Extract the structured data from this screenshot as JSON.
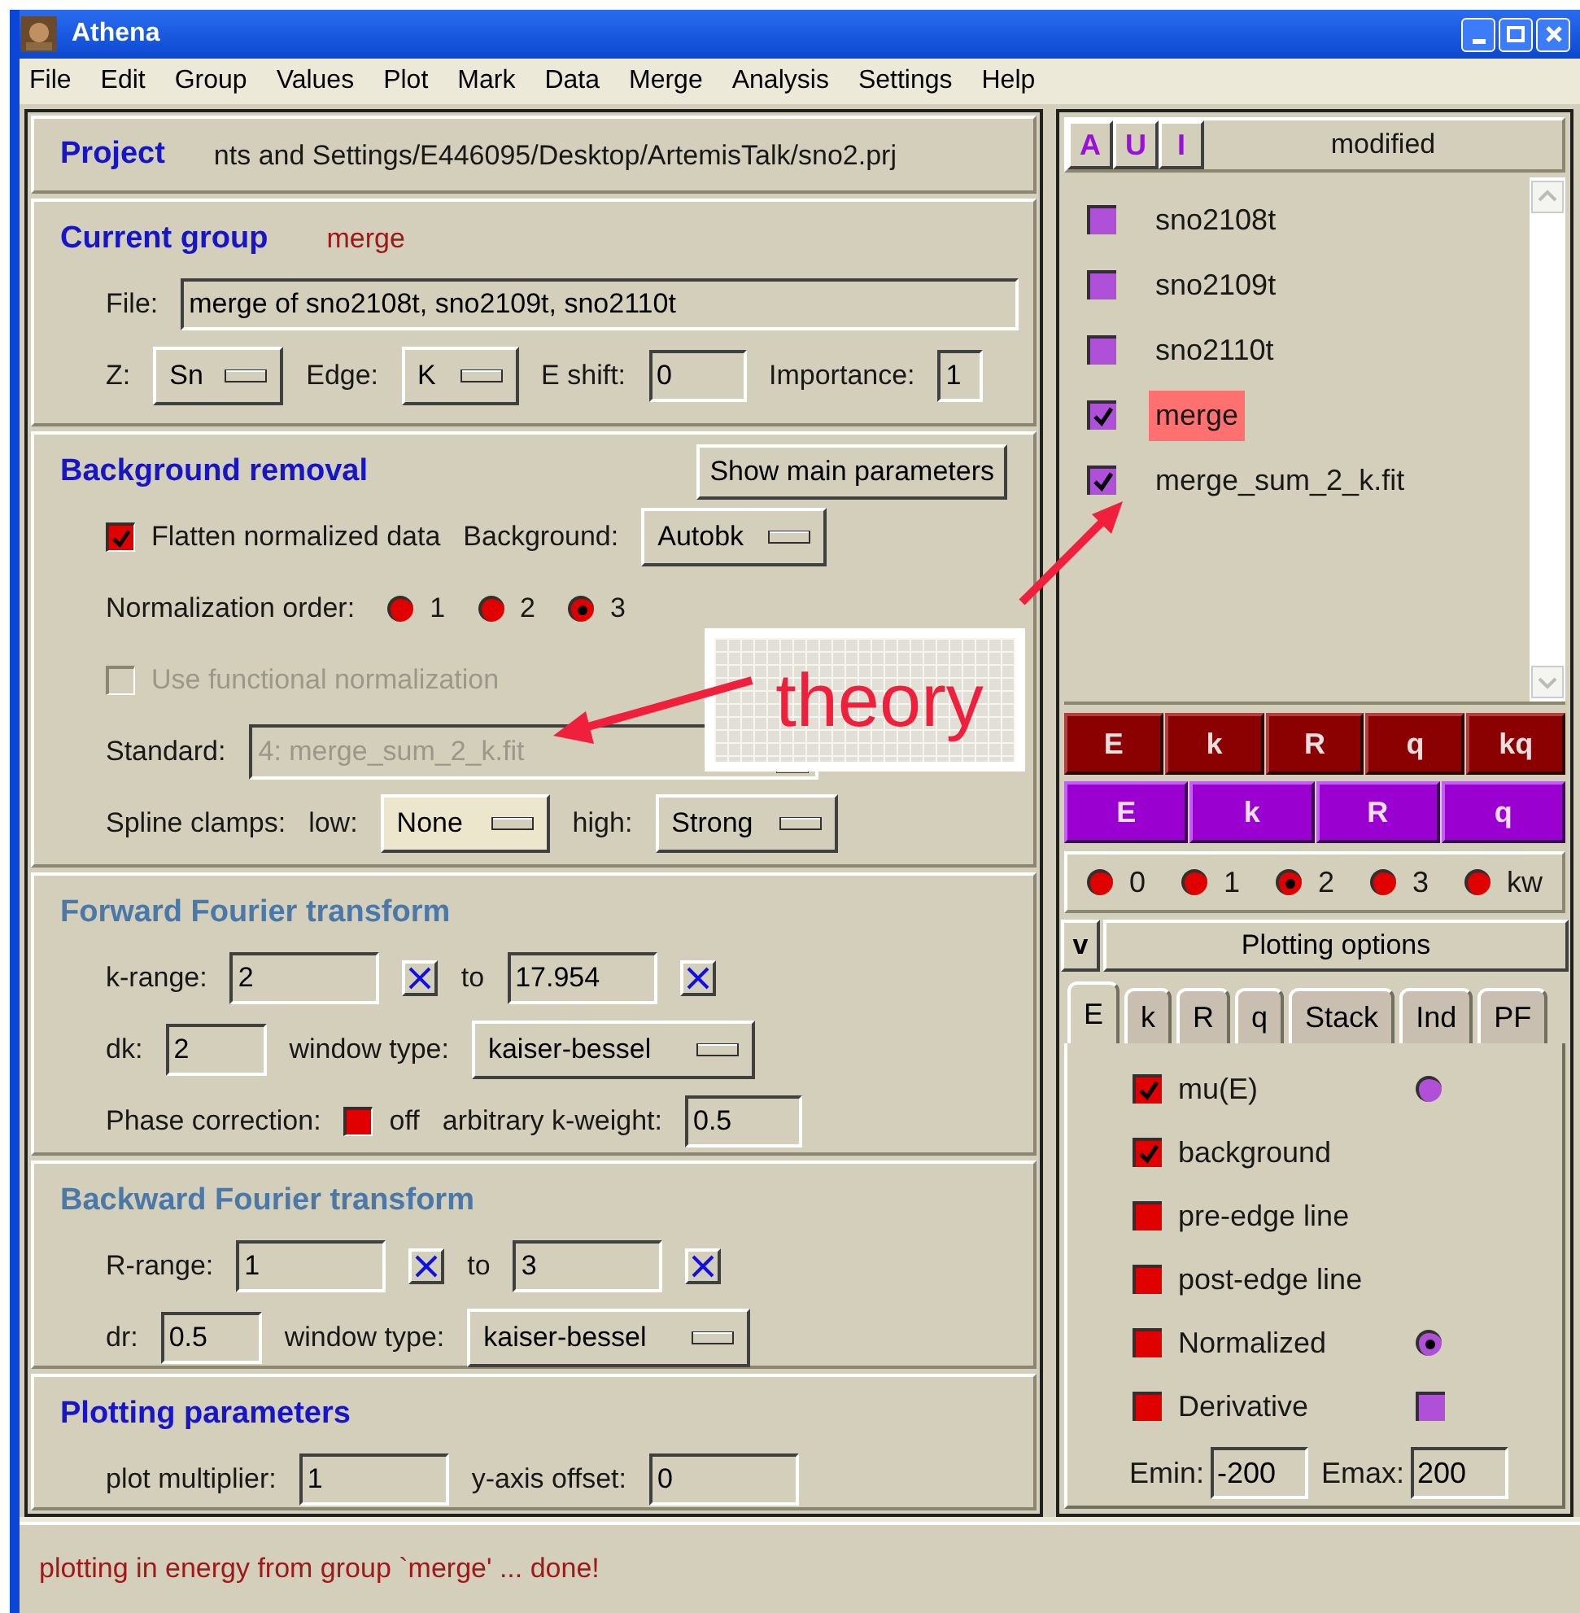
{
  "window": {
    "title": "Athena"
  },
  "menu": [
    {
      "label": "File"
    },
    {
      "label": "Edit"
    },
    {
      "label": "Group"
    },
    {
      "label": "Values"
    },
    {
      "label": "Plot"
    },
    {
      "label": "Mark"
    },
    {
      "label": "Data"
    },
    {
      "label": "Merge"
    },
    {
      "label": "Analysis"
    },
    {
      "label": "Settings"
    },
    {
      "label": "Help"
    }
  ],
  "sections": [
    {
      "dimmed": false,
      "header": [
        {
          "kind": "title",
          "text": "Project"
        },
        {
          "kind": "path",
          "text": "nts and Settings/E446095/Desktop/ArtemisTalk/sno2.prj"
        }
      ]
    },
    {
      "dimmed": false,
      "header": [
        {
          "kind": "title",
          "text": "Current group"
        },
        {
          "kind": "group-name",
          "text": "merge"
        }
      ],
      "rows": [
        {
          "controls": [
            {
              "kind": "label",
              "text": "File:"
            },
            {
              "kind": "field",
              "value": "merge of sno2108t, sno2109t, sno2110t"
            }
          ]
        },
        {
          "controls": [
            {
              "kind": "label",
              "text": "Z:"
            },
            {
              "kind": "dropdown",
              "value": "Sn"
            },
            {
              "kind": "label",
              "text": "Edge:"
            },
            {
              "kind": "dropdown",
              "value": "K"
            },
            {
              "kind": "label",
              "text": "E shift:"
            },
            {
              "kind": "field",
              "value": "0"
            },
            {
              "kind": "label",
              "text": "Importance:"
            },
            {
              "kind": "field",
              "value": "1"
            }
          ]
        }
      ]
    },
    {
      "dimmed": false,
      "header": [
        {
          "kind": "title",
          "text": "Background removal"
        },
        {
          "kind": "button",
          "text": "Show main parameters"
        }
      ],
      "rows": [
        {
          "controls": [
            {
              "kind": "checkbox",
              "text": "Flatten normalized data",
              "checked": true,
              "disabled": false
            },
            {
              "kind": "label",
              "text": "Background:"
            },
            {
              "kind": "dropdown",
              "value": "Autobk"
            }
          ]
        },
        {
          "controls": [
            {
              "kind": "label",
              "text": "Normalization order:"
            },
            {
              "kind": "radio",
              "text": "1",
              "selected": false
            },
            {
              "kind": "radio",
              "text": "2",
              "selected": false
            },
            {
              "kind": "radio",
              "text": "3",
              "selected": true
            }
          ]
        },
        {
          "controls": [
            {
              "kind": "checkbox",
              "text": "Use functional normalization",
              "checked": false,
              "disabled": true
            }
          ]
        },
        {
          "controls": [
            {
              "kind": "label",
              "text": "Standard:"
            },
            {
              "kind": "combo",
              "value": "4: merge_sum_2_k.fit",
              "disabled": true
            }
          ]
        },
        {
          "controls": [
            {
              "kind": "label",
              "text": "Spline clamps:"
            },
            {
              "kind": "label",
              "text": "low:"
            },
            {
              "kind": "dropdown",
              "value": "None"
            },
            {
              "kind": "label",
              "text": "high:"
            },
            {
              "kind": "dropdown",
              "value": "Strong"
            }
          ]
        }
      ]
    },
    {
      "dimmed": true,
      "header": [
        {
          "kind": "title",
          "text": "Forward Fourier transform"
        }
      ],
      "rows": [
        {
          "controls": [
            {
              "kind": "label",
              "text": "k-range:"
            },
            {
              "kind": "field",
              "value": "2"
            },
            {
              "kind": "pick"
            },
            {
              "kind": "label",
              "text": "to"
            },
            {
              "kind": "field",
              "value": "17.954"
            },
            {
              "kind": "pick"
            }
          ]
        },
        {
          "controls": [
            {
              "kind": "label",
              "text": "dk:"
            },
            {
              "kind": "field",
              "value": "2"
            },
            {
              "kind": "label",
              "text": "window type:"
            },
            {
              "kind": "dropdown",
              "value": "kaiser-bessel"
            }
          ]
        },
        {
          "controls": [
            {
              "kind": "label",
              "text": "Phase correction:"
            },
            {
              "kind": "checkbox",
              "text": "off",
              "checked": false,
              "disabled": false
            },
            {
              "kind": "label",
              "text": "arbitrary k-weight:"
            },
            {
              "kind": "field",
              "value": "0.5"
            }
          ]
        }
      ]
    },
    {
      "dimmed": true,
      "header": [
        {
          "kind": "title",
          "text": "Backward Fourier transform"
        }
      ],
      "rows": [
        {
          "controls": [
            {
              "kind": "label",
              "text": "R-range:"
            },
            {
              "kind": "field",
              "value": "1"
            },
            {
              "kind": "pick"
            },
            {
              "kind": "label",
              "text": "to"
            },
            {
              "kind": "field",
              "value": "3"
            },
            {
              "kind": "pick"
            }
          ]
        },
        {
          "controls": [
            {
              "kind": "label",
              "text": "dr:"
            },
            {
              "kind": "field",
              "value": "0.5"
            },
            {
              "kind": "label",
              "text": "window type:"
            },
            {
              "kind": "dropdown",
              "value": "kaiser-bessel"
            }
          ]
        }
      ]
    },
    {
      "dimmed": false,
      "header": [
        {
          "kind": "title",
          "text": "Plotting parameters"
        }
      ],
      "rows": [
        {
          "controls": [
            {
              "kind": "label",
              "text": "plot multiplier:"
            },
            {
              "kind": "field",
              "value": "1"
            },
            {
              "kind": "label",
              "text": "y-axis offset:"
            },
            {
              "kind": "field",
              "value": "0"
            }
          ]
        }
      ]
    }
  ],
  "group_list": {
    "mark_buttons": [
      "A",
      "U",
      "I"
    ],
    "header": "modified",
    "items": [
      {
        "name": "sno2108t",
        "checked": false,
        "selected": false
      },
      {
        "name": "sno2109t",
        "checked": false,
        "selected": false
      },
      {
        "name": "sno2110t",
        "checked": false,
        "selected": false
      },
      {
        "name": "merge",
        "checked": true,
        "selected": true
      },
      {
        "name": "merge_sum_2_k.fit",
        "checked": true,
        "selected": false
      }
    ]
  },
  "plot_current": [
    "E",
    "k",
    "R",
    "q",
    "kq"
  ],
  "plot_marked": [
    "E",
    "k",
    "R",
    "q"
  ],
  "k_weights": [
    {
      "label": "0",
      "selected": false
    },
    {
      "label": "1",
      "selected": false
    },
    {
      "label": "2",
      "selected": true
    },
    {
      "label": "3",
      "selected": false
    },
    {
      "label": "kw",
      "selected": false
    }
  ],
  "plotting_options": {
    "toggle": "v",
    "label": "Plotting options"
  },
  "tabs": [
    {
      "label": "E",
      "selected": true
    },
    {
      "label": "k",
      "selected": false
    },
    {
      "label": "R",
      "selected": false
    },
    {
      "label": "q",
      "selected": false
    },
    {
      "label": "Stack",
      "selected": false
    },
    {
      "label": "Ind",
      "selected": false
    },
    {
      "label": "PF",
      "selected": false
    }
  ],
  "energy_options": [
    {
      "label": "mu(E)",
      "checked": true,
      "marker": {
        "kind": "radio",
        "selected": false
      }
    },
    {
      "label": "background",
      "checked": true
    },
    {
      "label": "pre-edge line",
      "checked": false
    },
    {
      "label": "post-edge line",
      "checked": false
    },
    {
      "label": "Normalized",
      "checked": false,
      "marker": {
        "kind": "radio",
        "selected": true
      }
    },
    {
      "label": "Derivative",
      "checked": false,
      "marker": {
        "kind": "check",
        "checked": false
      }
    }
  ],
  "energy_range": {
    "emin_label": "Emin:",
    "emin": "-200",
    "emax_label": "Emax:",
    "emax": "200"
  },
  "status_bar": "plotting in energy from group `merge' ... done!",
  "annotation": {
    "text": "theory"
  }
}
